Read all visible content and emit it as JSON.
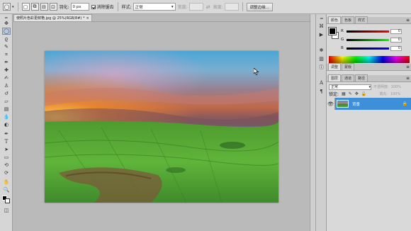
{
  "options_bar": {
    "feather_label": "羽化:",
    "feather_value": "0 px",
    "antialias_label": "消除锯齿",
    "style_label": "样式:",
    "style_value": "正常",
    "width_label": "宽度:",
    "height_label": "高度:",
    "refine_edge_label": "调整边缘..."
  },
  "document": {
    "tab_title": "使照片色彩更鲜艳.jpg @ 25%(RGB/8#) *",
    "close_glyph": "×"
  },
  "color_panel": {
    "tabs": [
      "颜色",
      "色板",
      "样式"
    ],
    "sliders": [
      {
        "label": "R",
        "value": "0",
        "gradient": "linear-gradient(90deg,#000,#f00)"
      },
      {
        "label": "G",
        "value": "0",
        "gradient": "linear-gradient(90deg,#000,#0f0)"
      },
      {
        "label": "B",
        "value": "0",
        "gradient": "linear-gradient(90deg,#000,#00f)"
      }
    ]
  },
  "adjust_panel": {
    "tabs": [
      "调整",
      "蒙版"
    ]
  },
  "layers_panel": {
    "tabs": [
      "图层",
      "通道",
      "路径"
    ],
    "blend_mode": "正常",
    "opacity_label": "不透明度:",
    "opacity_value": "100%",
    "lock_label": "锁定:",
    "fill_label": "填充:",
    "fill_value": "100%",
    "layer_name": "背景"
  },
  "colors": {
    "accent": "#3d8fd9",
    "workspace": "#bababa",
    "panel": "#d9d9d9"
  }
}
